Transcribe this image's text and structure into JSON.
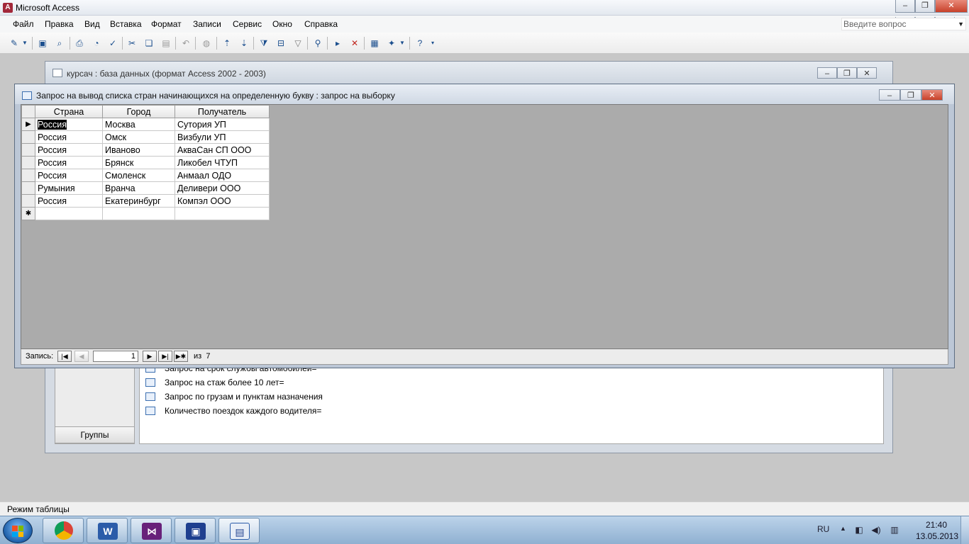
{
  "app": {
    "title": "Microsoft Access",
    "ask_placeholder": "Введите вопрос"
  },
  "menu": [
    "Файл",
    "Правка",
    "Вид",
    "Вставка",
    "Формат",
    "Записи",
    "Сервис",
    "Окно",
    "Справка"
  ],
  "db_window": {
    "title": "курсач : база данных (формат Access 2002 - 2003)",
    "groups_label": "Группы",
    "items": [
      "Запрос на срок службы автомобилей=",
      "Запрос на стаж более 10 лет=",
      "Запрос по грузам и пунктам назначения",
      "Количество поездок каждого водителя="
    ]
  },
  "query_window": {
    "title": "Запрос на вывод списка стран начинающихся на определенную букву : запрос на выборку",
    "columns": [
      "Страна",
      "Город",
      "Получатель"
    ],
    "rows": [
      [
        "Россия",
        "Москва",
        "Сутория УП"
      ],
      [
        "Россия",
        "Омск",
        "Визбули УП"
      ],
      [
        "Россия",
        "Иваново",
        "АкваСан СП ООО"
      ],
      [
        "Россия",
        "Брянск",
        "Ликобел ЧТУП"
      ],
      [
        "Россия",
        "Смоленск",
        "Анмаал ОДО"
      ],
      [
        "Румыния",
        "Вранча",
        "Деливери ООО"
      ],
      [
        "Россия",
        "Екатеринбург",
        "Компэл ООО"
      ]
    ],
    "new_row_marker": "✱",
    "nav": {
      "label": "Запись:",
      "current": "1",
      "of_label": "из",
      "total": "7"
    }
  },
  "status_bar": "Режим таблицы",
  "taskbar": {
    "apps": [
      "chrome-icon",
      "word-icon",
      "visual-studio-icon",
      "access-icon",
      "window-switcher-icon"
    ],
    "lang": "RU",
    "time": "21:40",
    "date": "13.05.2013"
  }
}
